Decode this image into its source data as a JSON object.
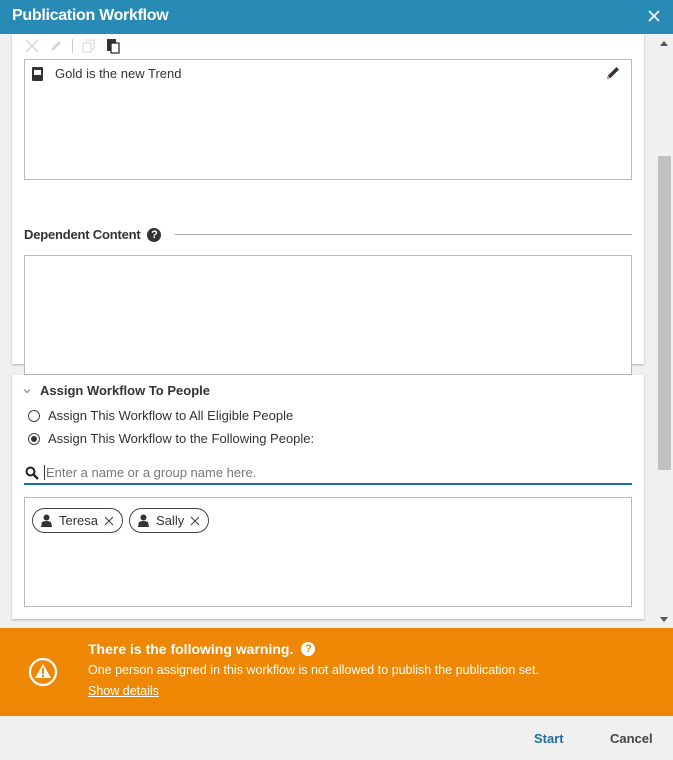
{
  "dialog": {
    "title": "Publication Workflow",
    "close_icon": "close-icon"
  },
  "content_panel": {
    "toolbar": {
      "icons": [
        "remove-icon",
        "edit-icon",
        "copy-icon",
        "paste-icon"
      ],
      "states": [
        "disabled",
        "disabled",
        "disabled",
        "enabled"
      ]
    },
    "items": [
      {
        "icon": "book-icon",
        "label": "Gold is the new Trend"
      }
    ],
    "edit_icon": "pencil-icon",
    "dependent_content": {
      "label": "Dependent Content",
      "help_icon": "help-icon",
      "help_glyph": "?",
      "items": []
    }
  },
  "assign_panel": {
    "title": "Assign Workflow To People",
    "collapse_icon": "chevron-down-icon",
    "options": [
      {
        "label": "Assign This Workflow to All Eligible People",
        "selected": false
      },
      {
        "label": "Assign This Workflow to the Following People:",
        "selected": true
      }
    ],
    "search": {
      "placeholder": "Enter a name or a group name here.",
      "value": "",
      "icon": "search-icon"
    },
    "people": [
      {
        "name": "Teresa",
        "icon": "person-icon"
      },
      {
        "name": "Sally",
        "icon": "person-icon"
      }
    ]
  },
  "warning": {
    "title": "There is the following warning.",
    "help_glyph": "?",
    "message": "One person assigned in this workflow is not allowed to publish the publication set.",
    "link": "Show details",
    "color": "#ee8703"
  },
  "footer": {
    "start_label": "Start",
    "cancel_label": "Cancel"
  },
  "colors": {
    "titlebar": "#278bb5",
    "accent": "#1f6ea5",
    "warning": "#ee8703"
  },
  "scrollbar": {
    "position_fraction": 0.38
  }
}
